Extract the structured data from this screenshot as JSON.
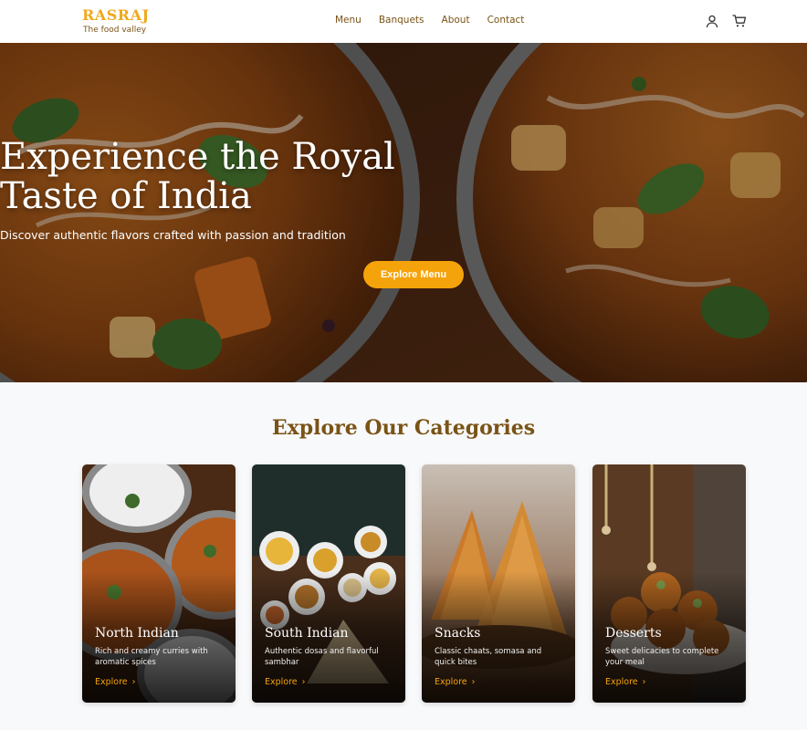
{
  "brand": {
    "name": "RASRAJ",
    "tagline": "The food valley"
  },
  "nav": {
    "links": [
      "Menu",
      "Banquets",
      "About",
      "Contact"
    ],
    "icons": [
      "user-icon",
      "cart-icon"
    ]
  },
  "hero": {
    "title_line1": "Experience the Royal",
    "title_line2": "Taste of India",
    "subtitle": "Discover authentic flavors crafted with passion and tradition",
    "cta": "Explore Menu"
  },
  "categories": {
    "heading": "Explore Our Categories",
    "items": [
      {
        "title": "North Indian",
        "desc": "Rich and creamy curries with aromatic spices",
        "link": "Explore"
      },
      {
        "title": "South Indian",
        "desc": "Authentic dosas and flavorful sambhar",
        "link": "Explore"
      },
      {
        "title": "Snacks",
        "desc": "Classic chaats, somasa and quick bites",
        "link": "Explore"
      },
      {
        "title": "Desserts",
        "desc": "Sweet delicacies to complete your meal",
        "link": "Explore"
      }
    ]
  },
  "colors": {
    "accent": "#f5a30a",
    "brand": "#f0a91b",
    "brown": "#7a5316"
  }
}
